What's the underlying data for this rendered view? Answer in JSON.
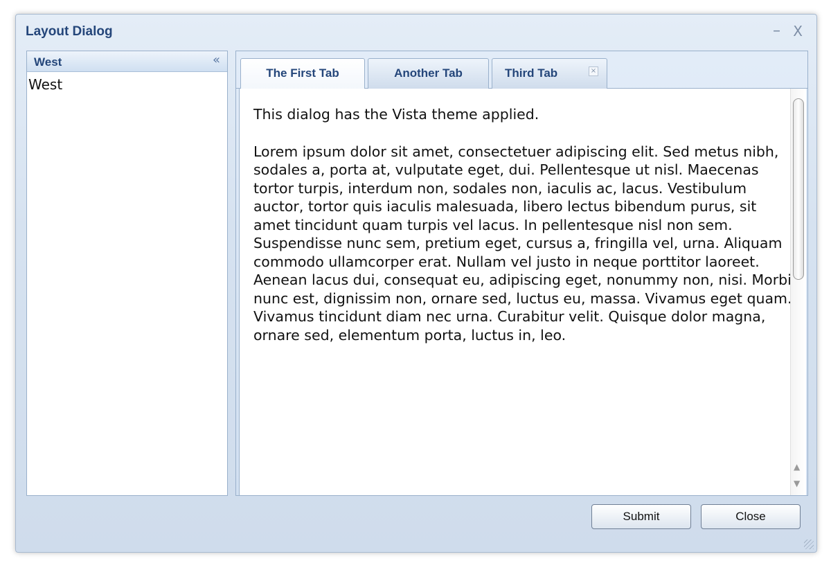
{
  "dialog": {
    "title": "Layout Dialog",
    "minimize_glyph": "–",
    "close_glyph": "X"
  },
  "west": {
    "header": "West",
    "collapse_glyph": "«",
    "body": "West"
  },
  "tabs": [
    {
      "label": "The First Tab",
      "active": true
    },
    {
      "label": "Another Tab",
      "active": false
    },
    {
      "label": "Third Tab",
      "active": false,
      "closable": true,
      "close_glyph": "×"
    }
  ],
  "content": {
    "intro": "This dialog has the Vista theme applied.",
    "body": "Lorem ipsum dolor sit amet, consectetuer adipiscing elit. Sed metus nibh, sodales a, porta at, vulputate eget, dui. Pellentesque ut nisl. Maecenas tortor turpis, interdum non, sodales non, iaculis ac, lacus. Vestibulum auctor, tortor quis iaculis malesuada, libero lectus bibendum purus, sit amet tincidunt quam turpis vel lacus. In pellentesque nisl non sem. Suspendisse nunc sem, pretium eget, cursus a, fringilla vel, urna. Aliquam commodo ullamcorper erat. Nullam vel justo in neque porttitor laoreet. Aenean lacus dui, consequat eu, adipiscing eget, nonummy non, nisi. Morbi nunc est, dignissim non, ornare sed, luctus eu, massa. Vivamus eget quam. Vivamus tincidunt diam nec urna. Curabitur velit. Quisque dolor magna, ornare sed, elementum porta, luctus in, leo."
  },
  "scrollbar": {
    "up_glyph": "▲",
    "down_glyph": "▼"
  },
  "buttons": {
    "submit": "Submit",
    "close": "Close"
  },
  "theme": {
    "accent": "#24467a",
    "border": "#99b0cb",
    "dialog_bg": "#d6e2f0"
  }
}
